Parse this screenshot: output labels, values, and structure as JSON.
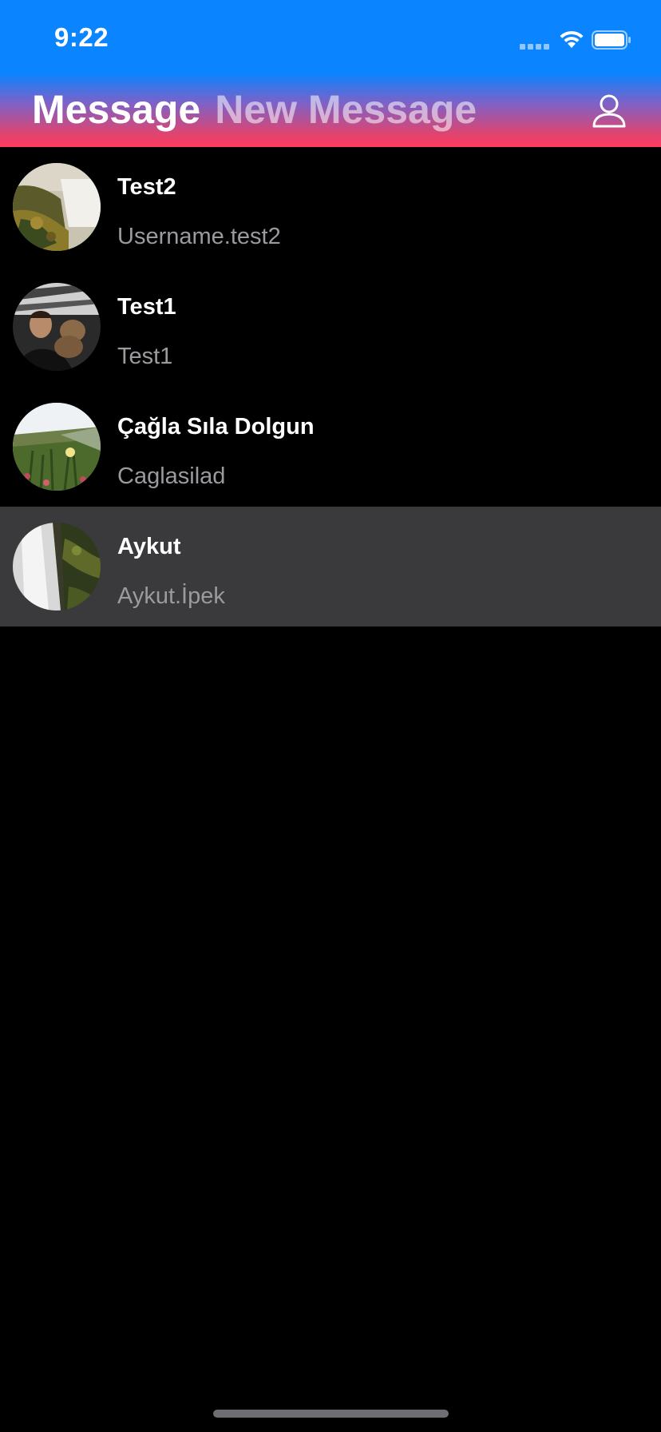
{
  "status_bar": {
    "time": "9:22",
    "signal_icon": "cellular-signal-icon",
    "wifi_icon": "wifi-icon",
    "battery_icon": "battery-icon"
  },
  "header": {
    "tabs": [
      {
        "label": "Message",
        "active": true
      },
      {
        "label": "New Message",
        "active": false
      }
    ],
    "profile_icon": "person-icon",
    "colors": {
      "top": "#0a84ff",
      "bottom": "#ff3b5f"
    }
  },
  "contacts": [
    {
      "name": "Test2",
      "username": "Username.test2",
      "avatar": "waterfall-landscape-photo",
      "selected": false
    },
    {
      "name": "Test1",
      "username": "Test1",
      "avatar": "person-with-dog-photo",
      "selected": false
    },
    {
      "name": "Çağla Sıla Dolgun",
      "username": "Caglasilad",
      "avatar": "flowers-field-photo",
      "selected": false
    },
    {
      "name": "Aykut",
      "username": "Aykut.İpek",
      "avatar": "waterfall-rocks-photo",
      "selected": true
    }
  ],
  "colors": {
    "background": "#000000",
    "selected_row": "#3a3a3c",
    "secondary_text": "#9a9a9f"
  }
}
